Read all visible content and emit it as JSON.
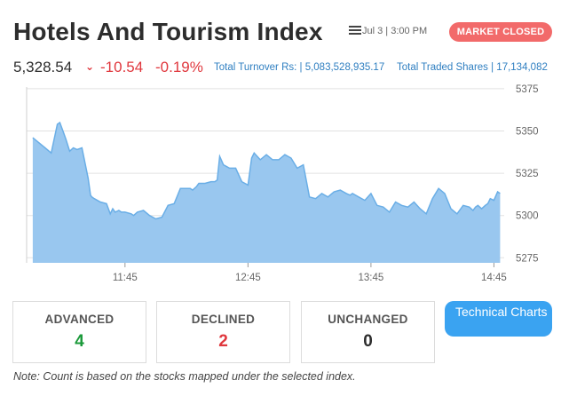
{
  "header": {
    "title": "Hotels And Tourism Index",
    "datetime": "Jul 3 | 3:00 PM",
    "market_status": "MARKET CLOSED"
  },
  "stats": {
    "price": "5,328.54",
    "change": "-10.54",
    "change_pct": "-0.19%",
    "turnover_text": "Total Turnover Rs: | 5,083,528,935.17",
    "traded_text": "Total Traded Shares | 17,134,082"
  },
  "summary": {
    "advanced_label": "ADVANCED",
    "advanced_value": "4",
    "declined_label": "DECLINED",
    "declined_value": "2",
    "unchanged_label": "UNCHANGED",
    "unchanged_value": "0"
  },
  "technical_button": "Technical Charts",
  "note": "Note: Count is based on the stocks mapped under the selected index.",
  "colors": {
    "area_fill": "#99c7ef",
    "area_line": "#6aaee6",
    "negative": "#e0383e",
    "positive": "#1b9a3a",
    "accent": "#3aa3f1",
    "badge": "#f26a6a"
  },
  "chart_data": {
    "type": "area",
    "x_ticks": [
      "11:45",
      "12:45",
      "13:45",
      "14:45"
    ],
    "y_ticks": [
      5275,
      5300,
      5325,
      5350,
      5375
    ],
    "ylim": [
      5272,
      5376
    ],
    "xlim": [
      10.95,
      15.05
    ],
    "grid": true,
    "x": [
      11.0,
      11.05,
      11.1,
      11.15,
      11.2,
      11.22,
      11.25,
      11.27,
      11.3,
      11.33,
      11.36,
      11.4,
      11.45,
      11.47,
      11.48,
      11.5,
      11.55,
      11.6,
      11.63,
      11.65,
      11.67,
      11.7,
      11.72,
      11.75,
      11.8,
      11.82,
      11.85,
      11.9,
      11.95,
      12.0,
      12.05,
      12.1,
      12.15,
      12.2,
      12.25,
      12.28,
      12.3,
      12.33,
      12.35,
      12.4,
      12.45,
      12.48,
      12.5,
      12.52,
      12.55,
      12.6,
      12.65,
      12.7,
      12.75,
      12.78,
      12.8,
      12.85,
      12.9,
      12.95,
      13.0,
      13.05,
      13.1,
      13.15,
      13.2,
      13.25,
      13.3,
      13.35,
      13.4,
      13.45,
      13.5,
      13.55,
      13.58,
      13.6,
      13.65,
      13.7,
      13.75,
      13.8,
      13.85,
      13.9,
      13.95,
      14.0,
      14.05,
      14.1,
      14.15,
      14.2,
      14.25,
      14.3,
      14.35,
      14.4,
      14.45,
      14.5,
      14.55,
      14.58,
      14.6,
      14.62,
      14.65,
      14.68,
      14.7,
      14.72,
      14.75,
      14.78,
      14.8
    ],
    "values": [
      5346,
      5343,
      5340,
      5337,
      5354,
      5355,
      5349,
      5345,
      5338,
      5340,
      5339,
      5340,
      5322,
      5312,
      5311,
      5310,
      5308,
      5307,
      5301,
      5304,
      5302,
      5303,
      5302,
      5302,
      5301,
      5300,
      5302,
      5303,
      5300,
      5298,
      5299,
      5306,
      5307,
      5316,
      5316,
      5316,
      5315,
      5317,
      5319,
      5319,
      5320,
      5320,
      5321,
      5335,
      5330,
      5328,
      5328,
      5320,
      5318,
      5334,
      5337,
      5333,
      5336,
      5333,
      5333,
      5336,
      5334,
      5328,
      5330,
      5311,
      5310,
      5313,
      5311,
      5314,
      5315,
      5313,
      5312,
      5313,
      5311,
      5309,
      5313,
      5306,
      5305,
      5302,
      5308,
      5306,
      5305,
      5308,
      5304,
      5301,
      5310,
      5316,
      5313,
      5304,
      5301,
      5306,
      5305,
      5303,
      5305,
      5306,
      5304,
      5306,
      5307,
      5310,
      5309,
      5314,
      5313,
      5314,
      5316,
      5313,
      5318,
      5316,
      5320,
      5314,
      5320,
      5322,
      5324,
      5330,
      5322,
      5326,
      5324,
      5328,
      5327,
      5337,
      5332,
      5318
    ]
  }
}
